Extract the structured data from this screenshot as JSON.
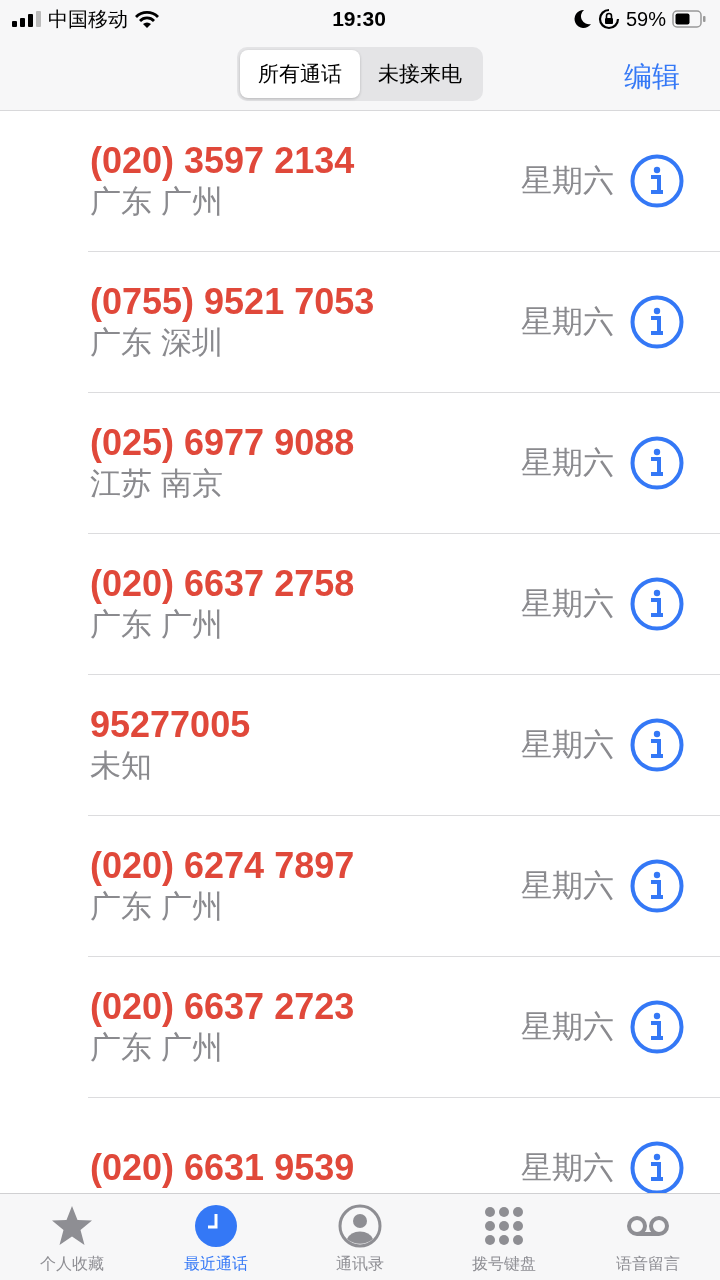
{
  "status_bar": {
    "carrier": "中国移动",
    "time": "19:30",
    "battery_percent": "59%"
  },
  "segments": [
    {
      "label": "所有通话",
      "selected": true
    },
    {
      "label": "未接来电",
      "selected": false
    }
  ],
  "edit_button": "编辑",
  "calls": [
    {
      "number": "(020) 3597 2134",
      "location": "广东 广州",
      "date": "星期六",
      "missed": true
    },
    {
      "number": "(0755) 9521 7053",
      "location": "广东 深圳",
      "date": "星期六",
      "missed": true
    },
    {
      "number": "(025) 6977 9088",
      "location": "江苏 南京",
      "date": "星期六",
      "missed": true
    },
    {
      "number": "(020) 6637 2758",
      "location": "广东 广州",
      "date": "星期六",
      "missed": true
    },
    {
      "number": "95277005",
      "location": "未知",
      "date": "星期六",
      "missed": true
    },
    {
      "number": "(020) 6274 7897",
      "location": "广东 广州",
      "date": "星期六",
      "missed": true
    },
    {
      "number": "(020) 6637 2723",
      "location": "广东 广州",
      "date": "星期六",
      "missed": true
    },
    {
      "number": "(020) 6631 9539",
      "date": "星期六",
      "missed": true
    }
  ],
  "tab_bar": [
    {
      "kind": "star",
      "label": "个人收藏",
      "selected": false
    },
    {
      "kind": "clock",
      "label": "最近通话",
      "selected": true
    },
    {
      "kind": "contact",
      "label": "通讯录",
      "selected": false
    },
    {
      "kind": "keypad",
      "label": "拨号键盘",
      "selected": false
    },
    {
      "kind": "voicemail",
      "label": "语音留言",
      "selected": false
    }
  ]
}
